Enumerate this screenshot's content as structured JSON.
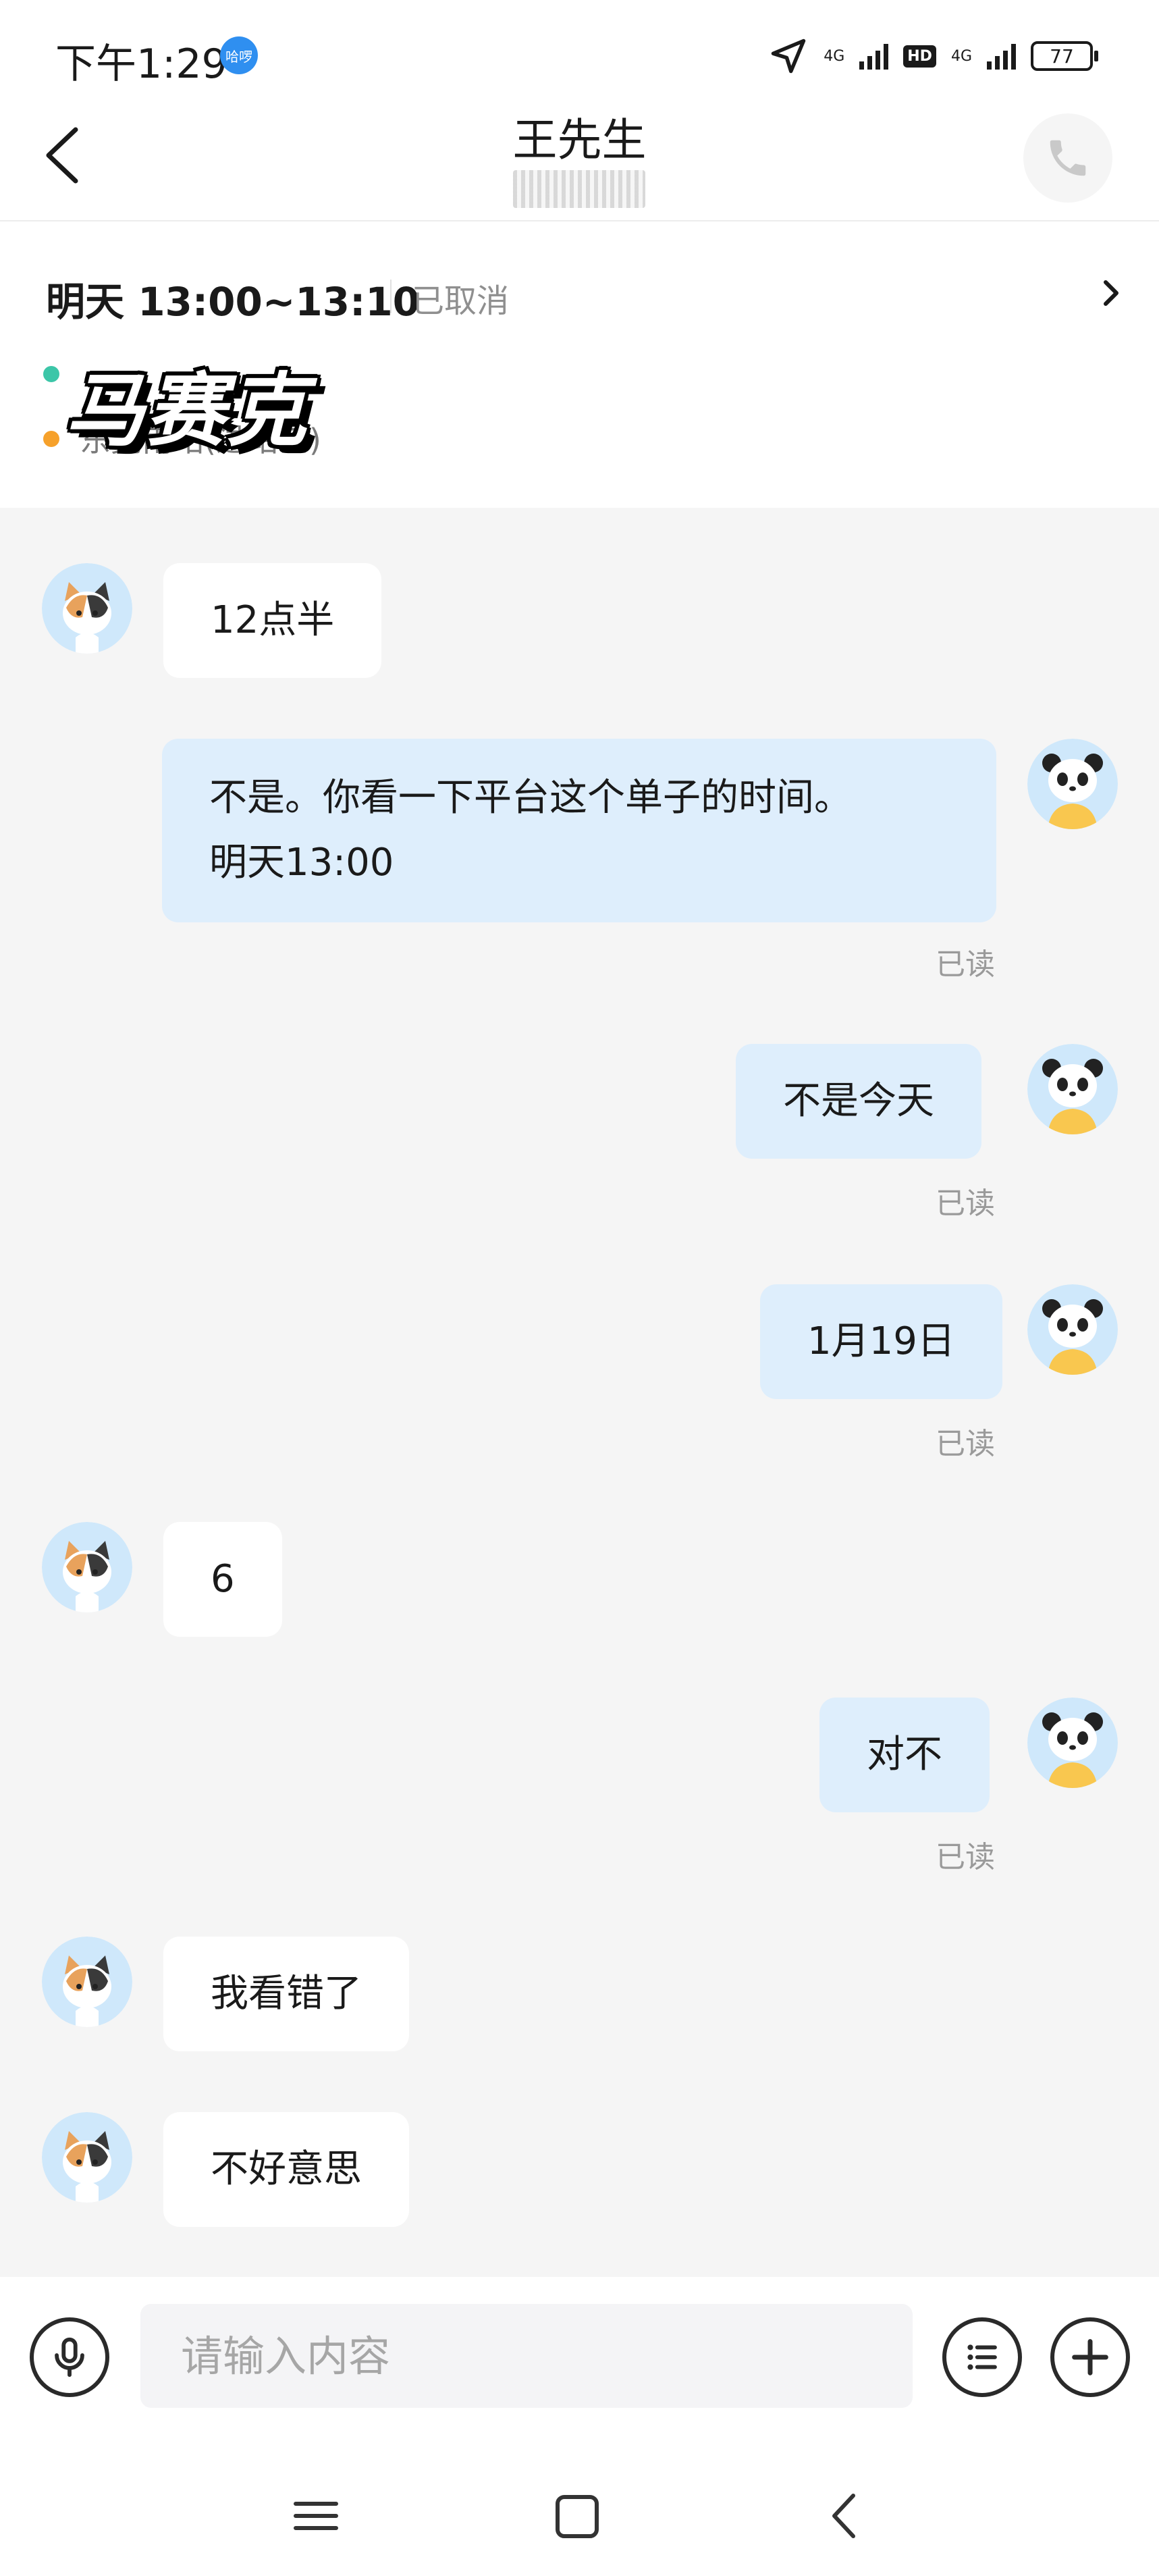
{
  "status_bar": {
    "time": "下午1:29",
    "app_badge": "哈啰",
    "network_1": "4G",
    "hd_label": "HD",
    "network_2": "4G",
    "battery": "77"
  },
  "header": {
    "title": "王先生",
    "back_icon": "chevron-left-icon",
    "call_icon": "phone-icon"
  },
  "order": {
    "time": "明天 13:00~13:10",
    "status": "已取消",
    "origin": "",
    "destination": "东莞南站(进站口)",
    "watermark_label": "马赛克"
  },
  "messages": [
    {
      "side": "in",
      "text": "12点半"
    },
    {
      "side": "out",
      "text": "不是。你看一下平台这个单子的时间。\n明天13:00",
      "read": "已读"
    },
    {
      "side": "out",
      "text": "不是今天",
      "read": "已读"
    },
    {
      "side": "out",
      "text": "1月19日",
      "read": "已读"
    },
    {
      "side": "in",
      "text": "6"
    },
    {
      "side": "out",
      "text": "对不",
      "read": "已读"
    },
    {
      "side": "in",
      "text": "我看错了"
    },
    {
      "side": "in",
      "text": "不好意思"
    }
  ],
  "input": {
    "placeholder": "请输入内容",
    "mic_icon": "microphone-icon",
    "menu_icon": "list-menu-icon",
    "add_icon": "plus-icon"
  },
  "colors": {
    "outgoing_bubble": "#deeefc",
    "incoming_bubble": "#ffffff",
    "chat_background": "#f5f5f5",
    "dot_origin": "#3cc6a8",
    "dot_destination": "#f6a12b"
  }
}
